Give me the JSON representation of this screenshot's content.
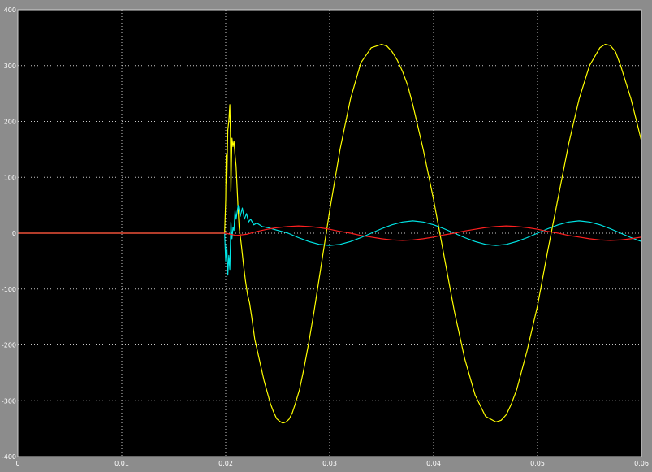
{
  "chart_data": {
    "type": "line",
    "xlim": [
      0,
      0.06
    ],
    "ylim": [
      -400,
      400
    ],
    "x_ticks": [
      0,
      0.01,
      0.02,
      0.03,
      0.04,
      0.05,
      0.06
    ],
    "x_tick_labels": [
      "0",
      "0.01",
      "0.02",
      "0.03",
      "0.04",
      "0.05",
      "0.06"
    ],
    "y_ticks": [
      -400,
      -300,
      -200,
      -100,
      0,
      100,
      200,
      300,
      400
    ],
    "y_tick_labels": [
      "-400",
      "-300",
      "-200",
      "-100",
      "0",
      "100",
      "200",
      "300",
      "400"
    ],
    "grid": true,
    "background_color": "#000000",
    "frame_color": "#8c8c8c",
    "series": [
      {
        "color": "#ffff00",
        "x": [
          0,
          0.0199,
          0.02,
          0.02005,
          0.0201,
          0.0202,
          0.0203,
          0.0204,
          0.02045,
          0.0205,
          0.0206,
          0.0207,
          0.0208,
          0.0209,
          0.021,
          0.0211,
          0.0212,
          0.0213,
          0.0215,
          0.0217,
          0.0219,
          0.0221,
          0.0223,
          0.0225,
          0.0228,
          0.0231,
          0.0234,
          0.0237,
          0.024,
          0.0243,
          0.0246,
          0.0249,
          0.0252,
          0.0255,
          0.0258,
          0.0261,
          0.0264,
          0.0267,
          0.0271,
          0.0275,
          0.028,
          0.0285,
          0.029,
          0.0295,
          0.03,
          0.0305,
          0.031,
          0.032,
          0.033,
          0.034,
          0.035,
          0.0355,
          0.036,
          0.0365,
          0.037,
          0.0375,
          0.038,
          0.039,
          0.04,
          0.041,
          0.042,
          0.043,
          0.044,
          0.045,
          0.046,
          0.0465,
          0.047,
          0.0475,
          0.048,
          0.049,
          0.05,
          0.051,
          0.052,
          0.053,
          0.054,
          0.055,
          0.056,
          0.0565,
          0.057,
          0.0575,
          0.058,
          0.059,
          0.06
        ],
        "y": [
          0,
          0,
          60,
          140,
          90,
          185,
          200,
          230,
          180,
          75,
          170,
          155,
          165,
          140,
          120,
          80,
          40,
          10,
          -20,
          -55,
          -85,
          -110,
          -125,
          -150,
          -190,
          -215,
          -240,
          -265,
          -285,
          -305,
          -320,
          -332,
          -337,
          -340,
          -338,
          -333,
          -322,
          -305,
          -280,
          -245,
          -195,
          -140,
          -80,
          -20,
          40,
          95,
          150,
          240,
          305,
          332,
          338,
          335,
          325,
          310,
          290,
          265,
          230,
          150,
          60,
          -40,
          -140,
          -225,
          -290,
          -328,
          -338,
          -335,
          -325,
          -305,
          -280,
          -210,
          -130,
          -30,
          65,
          160,
          240,
          300,
          332,
          338,
          336,
          325,
          300,
          240,
          165
        ]
      },
      {
        "color": "#00e5e5",
        "x": [
          0,
          0.0199,
          0.02,
          0.0201,
          0.0202,
          0.0203,
          0.0204,
          0.0205,
          0.0206,
          0.0207,
          0.0208,
          0.0209,
          0.021,
          0.0212,
          0.0214,
          0.0216,
          0.0218,
          0.022,
          0.0222,
          0.0224,
          0.0227,
          0.023,
          0.0235,
          0.024,
          0.025,
          0.026,
          0.027,
          0.028,
          0.029,
          0.03,
          0.031,
          0.032,
          0.033,
          0.034,
          0.035,
          0.036,
          0.037,
          0.038,
          0.039,
          0.04,
          0.041,
          0.042,
          0.043,
          0.044,
          0.045,
          0.046,
          0.047,
          0.048,
          0.049,
          0.05,
          0.051,
          0.052,
          0.053,
          0.054,
          0.055,
          0.056,
          0.057,
          0.058,
          0.059,
          0.06
        ],
        "y": [
          0,
          0,
          -50,
          -20,
          -75,
          -40,
          -65,
          20,
          -10,
          10,
          5,
          40,
          25,
          50,
          30,
          45,
          25,
          35,
          20,
          25,
          15,
          18,
          12,
          10,
          5,
          0,
          -8,
          -15,
          -20,
          -22,
          -20,
          -15,
          -8,
          0,
          8,
          15,
          20,
          22,
          20,
          15,
          8,
          0,
          -8,
          -15,
          -20,
          -22,
          -20,
          -15,
          -8,
          0,
          8,
          15,
          20,
          22,
          20,
          15,
          8,
          0,
          -8,
          -15
        ]
      },
      {
        "color": "#ff2020",
        "x": [
          0,
          0.02,
          0.021,
          0.022,
          0.023,
          0.024,
          0.025,
          0.026,
          0.027,
          0.028,
          0.029,
          0.03,
          0.031,
          0.032,
          0.033,
          0.034,
          0.035,
          0.036,
          0.037,
          0.038,
          0.039,
          0.04,
          0.041,
          0.042,
          0.043,
          0.044,
          0.045,
          0.046,
          0.047,
          0.048,
          0.049,
          0.05,
          0.051,
          0.052,
          0.053,
          0.054,
          0.055,
          0.056,
          0.057,
          0.058,
          0.059,
          0.06
        ],
        "y": [
          0,
          0,
          -4,
          -2,
          3,
          7,
          10,
          12,
          13,
          12,
          10,
          7,
          3,
          0,
          -4,
          -7,
          -10,
          -12,
          -13,
          -12,
          -10,
          -7,
          -3,
          0,
          4,
          7,
          10,
          12,
          13,
          12,
          10,
          7,
          3,
          0,
          -4,
          -7,
          -10,
          -12,
          -13,
          -12,
          -10,
          -7
        ]
      }
    ]
  }
}
